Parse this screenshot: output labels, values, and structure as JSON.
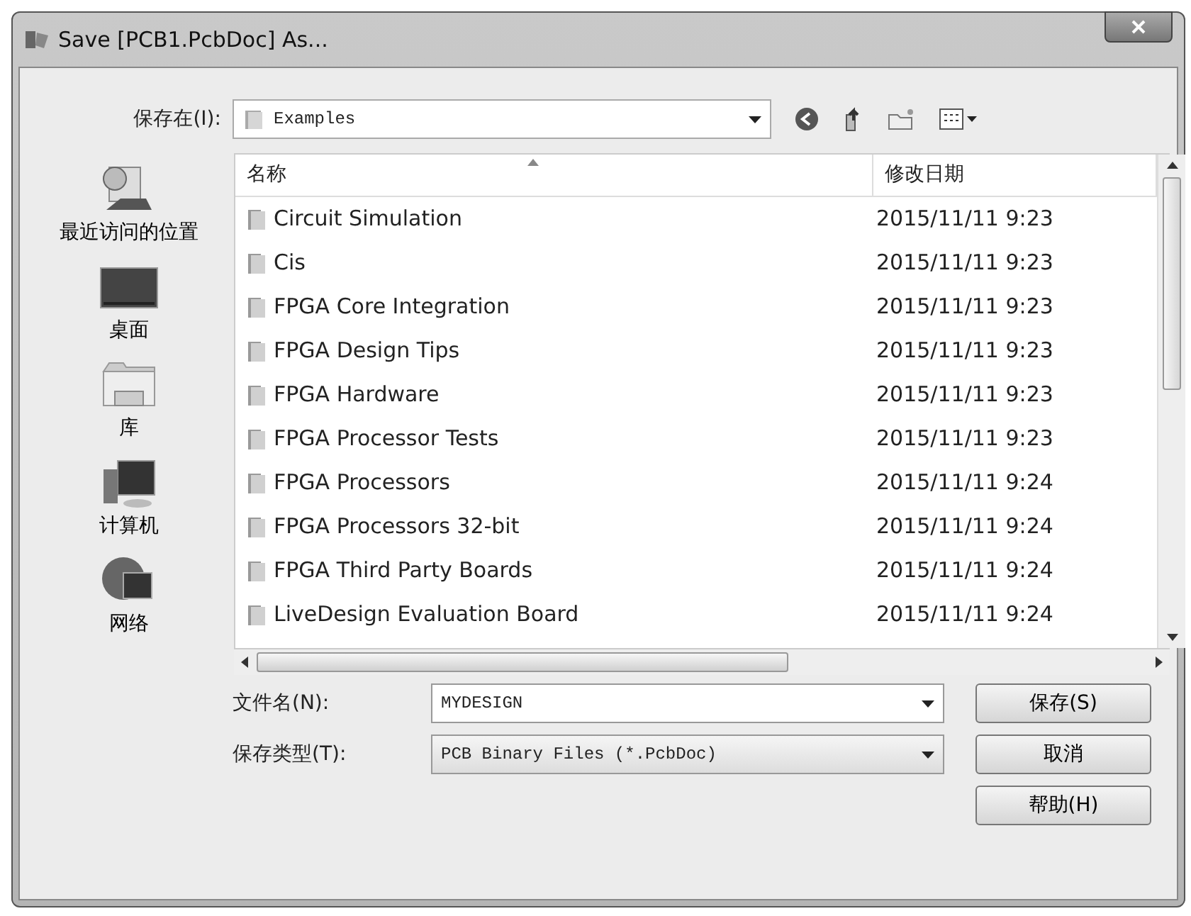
{
  "window": {
    "title": "Save [PCB1.PcbDoc] As..."
  },
  "location": {
    "label": "保存在(I):",
    "value": "Examples"
  },
  "places": [
    {
      "label": "最近访问的位置",
      "kind": "recent"
    },
    {
      "label": "桌面",
      "kind": "desktop"
    },
    {
      "label": "库",
      "kind": "library"
    },
    {
      "label": "计算机",
      "kind": "computer"
    },
    {
      "label": "网络",
      "kind": "network"
    }
  ],
  "file_list": {
    "columns": [
      "名称",
      "修改日期"
    ],
    "rows": [
      {
        "name": "Circuit Simulation",
        "date": "2015/11/11 9:23"
      },
      {
        "name": "Cis",
        "date": "2015/11/11 9:23"
      },
      {
        "name": "FPGA Core Integration",
        "date": "2015/11/11 9:23"
      },
      {
        "name": "FPGA Design Tips",
        "date": "2015/11/11 9:23"
      },
      {
        "name": "FPGA Hardware",
        "date": "2015/11/11 9:23"
      },
      {
        "name": "FPGA Processor Tests",
        "date": "2015/11/11 9:23"
      },
      {
        "name": "FPGA Processors",
        "date": "2015/11/11 9:24"
      },
      {
        "name": "FPGA Processors 32-bit",
        "date": "2015/11/11 9:24"
      },
      {
        "name": "FPGA Third Party Boards",
        "date": "2015/11/11 9:24"
      },
      {
        "name": "LiveDesign Evaluation Board",
        "date": "2015/11/11 9:24"
      }
    ]
  },
  "file_name": {
    "label": "文件名(N):",
    "value": "MYDESIGN"
  },
  "file_type": {
    "label": "保存类型(T):",
    "value": "PCB Binary Files (*.PcbDoc)"
  },
  "buttons": [
    "保存(S)",
    "取消",
    "帮助(H)"
  ]
}
